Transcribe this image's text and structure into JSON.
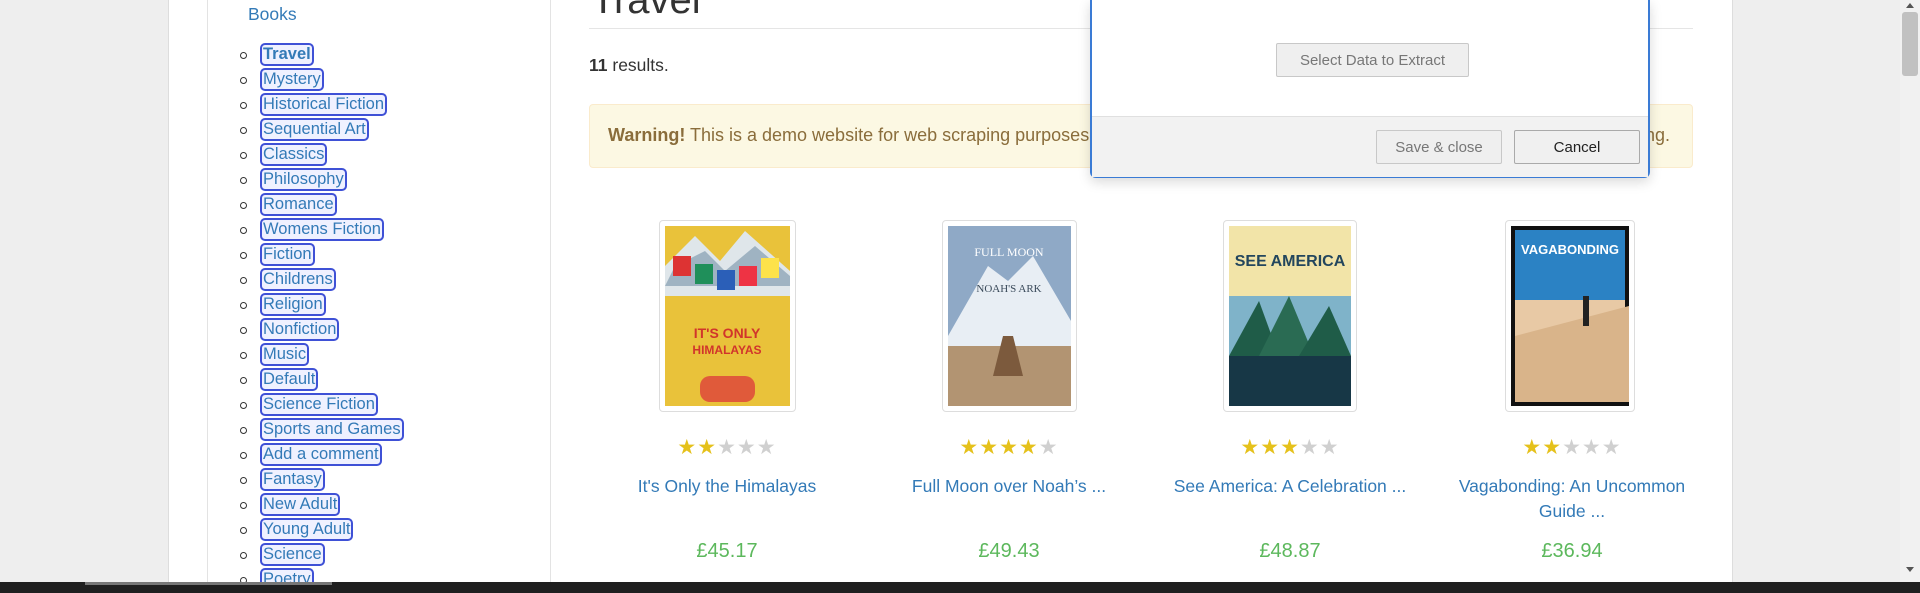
{
  "sidebar": {
    "books_label": "Books",
    "categories": [
      "Travel",
      "Mystery",
      "Historical Fiction",
      "Sequential Art",
      "Classics",
      "Philosophy",
      "Romance",
      "Womens Fiction",
      "Fiction",
      "Childrens",
      "Religion",
      "Nonfiction",
      "Music",
      "Default",
      "Science Fiction",
      "Sports and Games",
      "Add a comment",
      "Fantasy",
      "New Adult",
      "Young Adult",
      "Science",
      "Poetry"
    ]
  },
  "main": {
    "page_title": "Travel",
    "results_count": "11",
    "results_suffix": " results.",
    "warning_strong": "Warning!",
    "warning_text": " This is a demo website for web scraping purposes. F",
    "warning_tail": "ng."
  },
  "books": [
    {
      "title": "It's Only the Himalayas",
      "price": "£45.17",
      "rating": 2
    },
    {
      "title": "Full Moon over Noah’s ...",
      "price": "£49.43",
      "rating": 4
    },
    {
      "title": "See America: A Celebration ...",
      "price": "£48.87",
      "rating": 3
    },
    {
      "title": "Vagabonding: An Uncommon Guide ...",
      "price": "£36.94",
      "rating": 2
    }
  ],
  "dialog": {
    "select_data_label": "Select Data to Extract",
    "save_label": "Save & close",
    "cancel_label": "Cancel"
  },
  "colors": {
    "link": "#337ab7",
    "price": "#5cb85c",
    "star_on": "#e5c11b",
    "star_off": "#d0d0d0",
    "highlight_border": "#3f51d6",
    "dialog_border": "#3a7bd5"
  }
}
